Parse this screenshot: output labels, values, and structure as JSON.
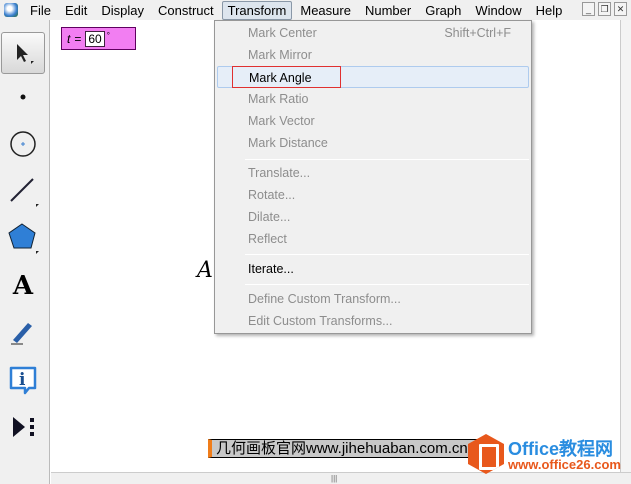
{
  "menubar": {
    "items": [
      "File",
      "Edit",
      "Display",
      "Construct",
      "Transform",
      "Measure",
      "Number",
      "Graph",
      "Window",
      "Help"
    ],
    "active": "Transform"
  },
  "parameter": {
    "name": "t",
    "equals": "=",
    "value": "60",
    "unit": "°"
  },
  "canvas": {
    "label": "A"
  },
  "transform_menu": {
    "items": [
      {
        "label": "Mark Center",
        "shortcut": "Shift+Ctrl+F",
        "enabled": false
      },
      {
        "label": "Mark Mirror",
        "enabled": false
      },
      {
        "label": "Mark Angle",
        "enabled": true,
        "highlighted": true
      },
      {
        "label": "Mark Ratio",
        "enabled": false
      },
      {
        "label": "Mark Vector",
        "enabled": false
      },
      {
        "label": "Mark Distance",
        "enabled": false
      },
      {
        "label": "Translate...",
        "enabled": false
      },
      {
        "label": "Rotate...",
        "enabled": false
      },
      {
        "label": "Dilate...",
        "enabled": false
      },
      {
        "label": "Reflect",
        "enabled": false
      },
      {
        "label": "Iterate...",
        "enabled": true
      },
      {
        "label": "Define Custom Transform...",
        "enabled": false
      },
      {
        "label": "Edit Custom Transforms...",
        "enabled": false
      }
    ]
  },
  "watermark": {
    "text": "几何画板官网www.jihehuaban.com.cn",
    "logo_line1": "Office教程网",
    "logo_line2": "www.office26.com"
  },
  "colors": {
    "param_bg": "#f27ef2",
    "highlight_box": "#e03030",
    "accent_orange": "#e8581c"
  }
}
